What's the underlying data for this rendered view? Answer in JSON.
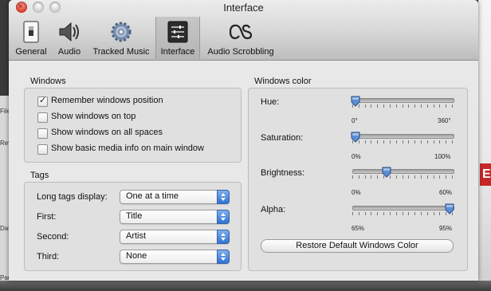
{
  "window": {
    "title": "Interface"
  },
  "toolbar": {
    "items": [
      {
        "label": "General",
        "icon": "switch-icon"
      },
      {
        "label": "Audio",
        "icon": "speaker-icon"
      },
      {
        "label": "Tracked Music",
        "icon": "gear-icon"
      },
      {
        "label": "Interface",
        "icon": "sliders-icon",
        "selected": true
      },
      {
        "label": "Audio Scrobbling",
        "icon": "lastfm-icon"
      }
    ]
  },
  "windows_group": {
    "title": "Windows",
    "options": [
      {
        "label": "Remember windows position",
        "checked": true
      },
      {
        "label": "Show windows on top",
        "checked": false
      },
      {
        "label": "Show windows on all spaces",
        "checked": false
      },
      {
        "label": "Show basic media info on main window",
        "checked": false
      }
    ]
  },
  "tags_group": {
    "title": "Tags",
    "fields": [
      {
        "label": "Long tags display:",
        "value": "One at a time"
      },
      {
        "label": "First:",
        "value": "Title"
      },
      {
        "label": "Second:",
        "value": "Artist"
      },
      {
        "label": "Third:",
        "value": "None"
      }
    ]
  },
  "color_group": {
    "title": "Windows color",
    "sliders": [
      {
        "label": "Hue:",
        "min": "0°",
        "max": "360°",
        "level": 0.0
      },
      {
        "label": "Saturation:",
        "min": "0%",
        "max": "100%",
        "level": 0.0
      },
      {
        "label": "Brightness:",
        "min": "0%",
        "max": "60%",
        "level": 0.33
      },
      {
        "label": "Alpha:",
        "min": "65%",
        "max": "95%",
        "level": 1.0
      }
    ],
    "restore_label": "Restore Default Windows Color"
  },
  "background": {
    "left_fragments": [
      "File",
      "Rev",
      "Dat",
      "Pau"
    ],
    "right_letter": "E"
  },
  "colors": {
    "select_accent": "#2f73d4",
    "close_button": "#d8392a",
    "knob": "#5a8fd6"
  }
}
